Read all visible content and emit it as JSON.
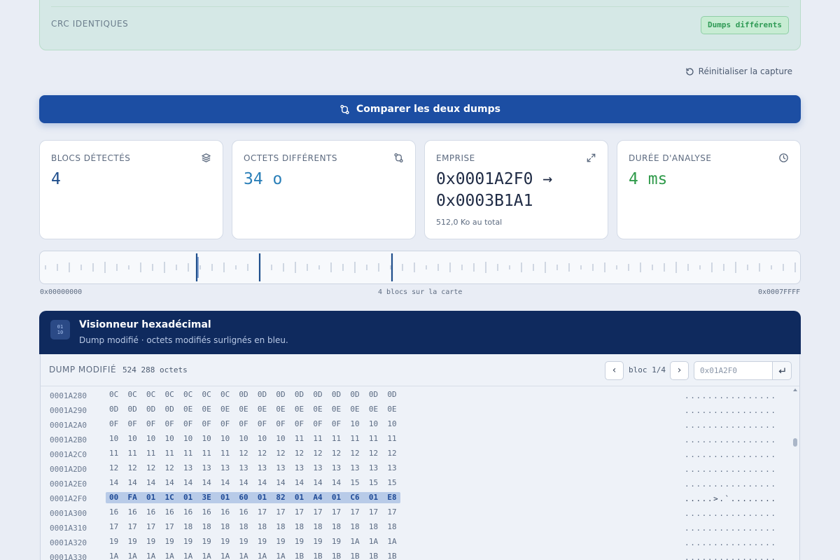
{
  "crc": {
    "label": "CRC IDENTIQUES",
    "badge": "Dumps différents"
  },
  "reset_label": "Réinitialiser la capture",
  "compare_label": "Comparer les deux dumps",
  "stats": [
    {
      "label": "BLOCS DÉTECTÉS",
      "value": "4",
      "icon": "layers-icon",
      "color": "#1f4e8c"
    },
    {
      "label": "OCTETS DIFFÉRENTS",
      "value": "34 o",
      "icon": "diff-icon",
      "color": "#2a7fb8"
    },
    {
      "label": "EMPRISE",
      "value_line1": "0x0001A2F0 →",
      "value_line2": "0x0003B1A1",
      "sub": "512,0 Ko au total",
      "icon": "expand-icon",
      "color": "#1e2a44"
    },
    {
      "label": "DURÉE D'ANALYSE",
      "value": "4 ms",
      "icon": "clock-icon",
      "color": "#2f9a4a"
    }
  ],
  "map": {
    "start": "0x00000000",
    "end": "0x0007FFFF",
    "caption": "4 blocs sur la carte"
  },
  "viewer": {
    "title": "Visionneur hexadécimal",
    "subtitle": "Dump modifié · octets modifiés surlignés en bleu.",
    "icon_text": "01 10",
    "dump_label": "DUMP MODIFIÉ",
    "dump_count": "524 288 octets",
    "bloc_label": "bloc 1/4",
    "prev": "‹",
    "next": "›",
    "address_placeholder": "0x01A2F0",
    "rows": [
      {
        "addr": "0001A280",
        "bytes": "0C  0C  0C  0C  0C  0C  0C  0D  0D  0D  0D  0D  0D  0D  0D  0D",
        "ascii": "................"
      },
      {
        "addr": "0001A290",
        "bytes": "0D  0D  0D  0D  0E  0E  0E  0E  0E  0E  0E  0E  0E  0E  0E  0E",
        "ascii": "................"
      },
      {
        "addr": "0001A2A0",
        "bytes": "0F  0F  0F  0F  0F  0F  0F  0F  0F  0F  0F  0F  0F  10  10  10",
        "ascii": "................"
      },
      {
        "addr": "0001A2B0",
        "bytes": "10  10  10  10  10  10  10  10  10  10  11  11  11  11  11  11",
        "ascii": "................"
      },
      {
        "addr": "0001A2C0",
        "bytes": "11  11  11  11  11  11  11  12  12  12  12  12  12  12  12  12",
        "ascii": "................"
      },
      {
        "addr": "0001A2D0",
        "bytes": "12  12  12  12  13  13  13  13  13  13  13  13  13  13  13  13",
        "ascii": "................"
      },
      {
        "addr": "0001A2E0",
        "bytes": "14  14  14  14  14  14  14  14  14  14  14  14  14  15  15  15",
        "ascii": "................"
      },
      {
        "addr": "0001A2F0",
        "bytes": "00  FA  01  1C  01  3E  01  60  01  82  01  A4  01  C6  01  E8",
        "ascii": ".....>.`........",
        "highlight": true
      },
      {
        "addr": "0001A300",
        "bytes": "16  16  16  16  16  16  16  16  17  17  17  17  17  17  17  17",
        "ascii": "................"
      },
      {
        "addr": "0001A310",
        "bytes": "17  17  17  17  18  18  18  18  18  18  18  18  18  18  18  18",
        "ascii": "................"
      },
      {
        "addr": "0001A320",
        "bytes": "19  19  19  19  19  19  19  19  19  19  19  19  19  1A  1A  1A",
        "ascii": "................"
      },
      {
        "addr": "0001A330",
        "bytes": "1A  1A  1A  1A  1A  1A  1A  1A  1A  1A  1B  1B  1B  1B  1B  1B",
        "ascii": "................"
      }
    ]
  }
}
